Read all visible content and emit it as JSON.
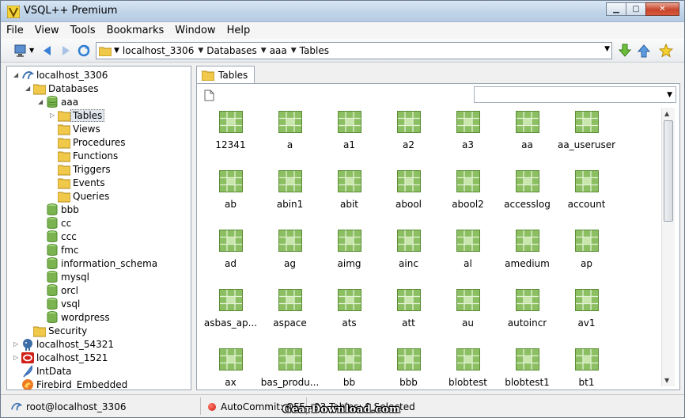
{
  "window": {
    "title": "VSQL++ Premium"
  },
  "menu": [
    "File",
    "View",
    "Tools",
    "Bookmarks",
    "Window",
    "Help"
  ],
  "breadcrumb": [
    "localhost_3306",
    "Databases",
    "aaa",
    "Tables"
  ],
  "tree": {
    "root": "localhost_3306",
    "databases_folder": "Databases",
    "open_db": "aaa",
    "aaa_children": [
      "Tables",
      "Views",
      "Procedures",
      "Functions",
      "Triggers",
      "Events",
      "Queries"
    ],
    "other_dbs": [
      "bbb",
      "cc",
      "ccc",
      "fmc",
      "information_schema",
      "mysql",
      "orcl",
      "vsql",
      "wordpress"
    ],
    "security": "Security",
    "connections": [
      "localhost_54321",
      "localhost_1521",
      "IntData",
      "Firebird_Embedded"
    ]
  },
  "tab": {
    "label": "Tables"
  },
  "tables": [
    "12341",
    "a",
    "a1",
    "a2",
    "a3",
    "aa",
    "aa_useruser",
    "ab",
    "abin1",
    "abit",
    "abool",
    "abool2",
    "accesslog",
    "account",
    "ad",
    "ag",
    "aimg",
    "ainc",
    "al",
    "amedium",
    "ap",
    "asbas_ap...",
    "aspace",
    "ats",
    "att",
    "au",
    "autoincr",
    "av1",
    "ax",
    "bas_produ...",
    "bb",
    "bbb",
    "blobtest",
    "blobtest1",
    "bt1"
  ],
  "status": {
    "connection": "root@localhost_3306",
    "autocommit": "AutoCommit: OFF",
    "summary": "93 Tables; 0 Selected"
  },
  "watermark": "GearDownload.com",
  "colors": {
    "table_icon": "#8cbf62",
    "folder": "#f0c84a",
    "db_icon": "#7ab350"
  }
}
